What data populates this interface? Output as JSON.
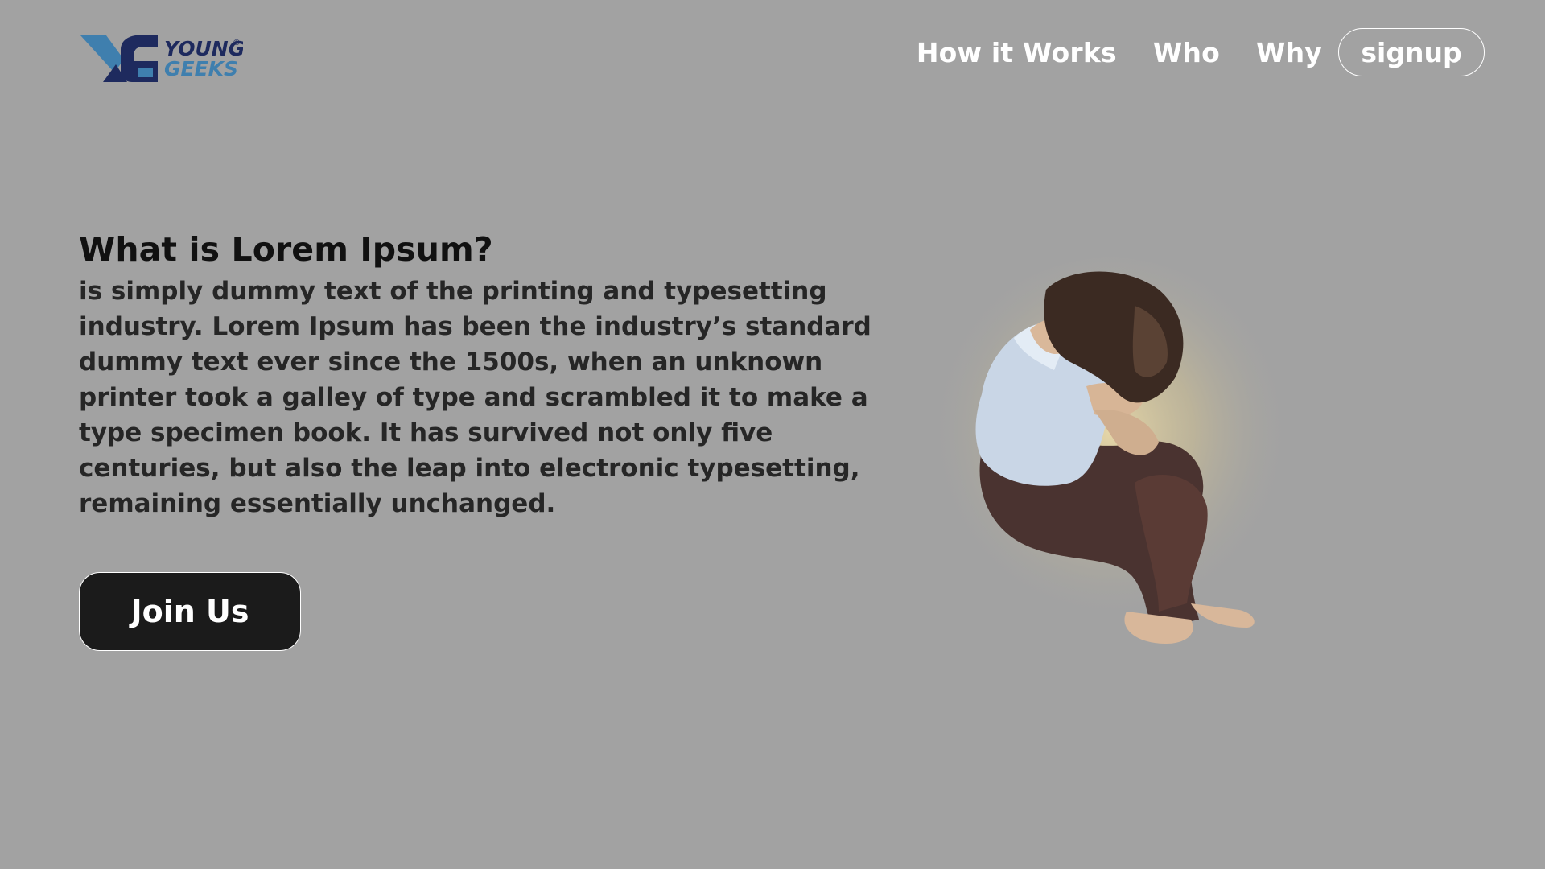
{
  "header": {
    "logo": {
      "line1": "YOUNG",
      "line2": "GEEKS",
      "mark": "®"
    },
    "nav": {
      "items": [
        {
          "label": "How it Works"
        },
        {
          "label": "Who"
        },
        {
          "label": "Why"
        }
      ],
      "signup_label": "signup"
    }
  },
  "hero": {
    "title": "What is Lorem Ipsum?",
    "body": "is simply dummy text of the printing and typesetting industry. Lorem Ipsum has been the industry’s standard dummy text ever since the 1500s, when an unknown printer took a galley of type and scrambled it to make a type specimen book. It has survived not only five centuries, but also the leap into electronic typesetting, remaining essentially unchanged.",
    "cta_label": "Join Us"
  },
  "illustration": {
    "icon": "crouching-person-illustration"
  },
  "colors": {
    "background": "#a2a2a2",
    "logo_dark": "#1e2a5e",
    "logo_light": "#3f7fae",
    "button_dark": "#1b1b1b",
    "text_white": "#ffffff"
  }
}
